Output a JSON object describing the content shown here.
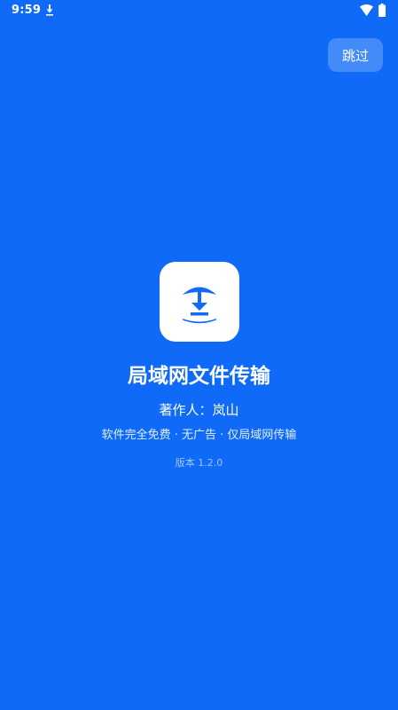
{
  "status_bar": {
    "time": "9:59"
  },
  "splash": {
    "skip_label": "跳过",
    "app_name": "局域网文件传输",
    "author": "著作人：岚山",
    "tagline": "软件完全免费 · 无广告 · 仅局域网传输",
    "version": "版本 1.2.0"
  },
  "colors": {
    "background": "#0f6bf7",
    "icon_tile": "#ffffff",
    "icon_glyph": "#0f6bf7"
  },
  "icons": {
    "app": "download-into-bowl-icon",
    "status": [
      "download-notification-icon",
      "wifi-icon",
      "battery-icon"
    ]
  }
}
